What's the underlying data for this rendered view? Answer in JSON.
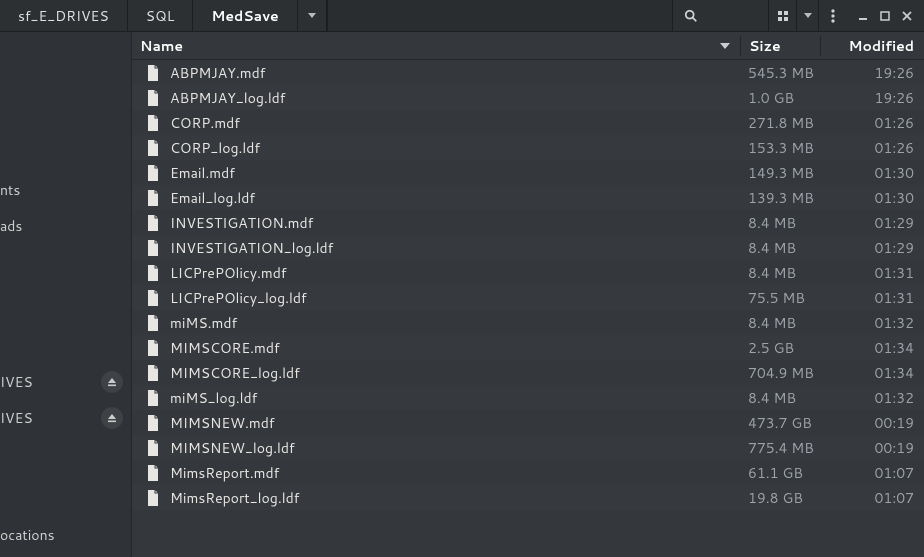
{
  "breadcrumbs": {
    "items": [
      {
        "label": "sf_E_DRIVES"
      },
      {
        "label": "SQL"
      },
      {
        "label": "MedSave"
      }
    ]
  },
  "toolbar": {
    "search_icon": "search-icon",
    "icon_view_icon": "icon-view-icon",
    "view_dropdown_icon": "chevron-down-icon",
    "hamburger_icon": "menu-icon",
    "minimize_icon": "window-minimize-icon",
    "maximize_icon": "window-maximize-icon",
    "close_icon": "window-close-icon"
  },
  "sidebar": {
    "items": [
      {
        "label": "nts",
        "eject": false
      },
      {
        "label": "ads",
        "eject": false
      }
    ],
    "drives": [
      {
        "label": "IVES",
        "eject": true
      },
      {
        "label": "IVES",
        "eject": true
      }
    ],
    "footer": [
      {
        "label": "ocations"
      }
    ]
  },
  "columns": {
    "name": "Name",
    "size": "Size",
    "modified": "Modified",
    "sort_column": "name",
    "sort_dir": "desc"
  },
  "files": [
    {
      "name": "ABPMJAY.mdf",
      "size": "545.3 MB",
      "modified": "19:26"
    },
    {
      "name": "ABPMJAY_log.ldf",
      "size": "1.0 GB",
      "modified": "19:26"
    },
    {
      "name": "CORP.mdf",
      "size": "271.8 MB",
      "modified": "01:26"
    },
    {
      "name": "CORP_log.ldf",
      "size": "153.3 MB",
      "modified": "01:26"
    },
    {
      "name": "Email.mdf",
      "size": "149.3 MB",
      "modified": "01:30"
    },
    {
      "name": "Email_log.ldf",
      "size": "139.3 MB",
      "modified": "01:30"
    },
    {
      "name": "INVESTIGATION.mdf",
      "size": "8.4 MB",
      "modified": "01:29"
    },
    {
      "name": "INVESTIGATION_log.ldf",
      "size": "8.4 MB",
      "modified": "01:29"
    },
    {
      "name": "LICPrePOlicy.mdf",
      "size": "8.4 MB",
      "modified": "01:31"
    },
    {
      "name": "LICPrePOlicy_log.ldf",
      "size": "75.5 MB",
      "modified": "01:31"
    },
    {
      "name": "miMS.mdf",
      "size": "8.4 MB",
      "modified": "01:32"
    },
    {
      "name": "MIMSCORE.mdf",
      "size": "2.5 GB",
      "modified": "01:34"
    },
    {
      "name": "MIMSCORE_log.ldf",
      "size": "704.9 MB",
      "modified": "01:34"
    },
    {
      "name": "miMS_log.ldf",
      "size": "8.4 MB",
      "modified": "01:32"
    },
    {
      "name": "MIMSNEW.mdf",
      "size": "473.7 GB",
      "modified": "00:19"
    },
    {
      "name": "MIMSNEW_log.ldf",
      "size": "775.4 MB",
      "modified": "00:19"
    },
    {
      "name": "MimsReport.mdf",
      "size": "61.1 GB",
      "modified": "01:07"
    },
    {
      "name": "MimsReport_log.ldf",
      "size": "19.8 GB",
      "modified": "01:07"
    }
  ]
}
